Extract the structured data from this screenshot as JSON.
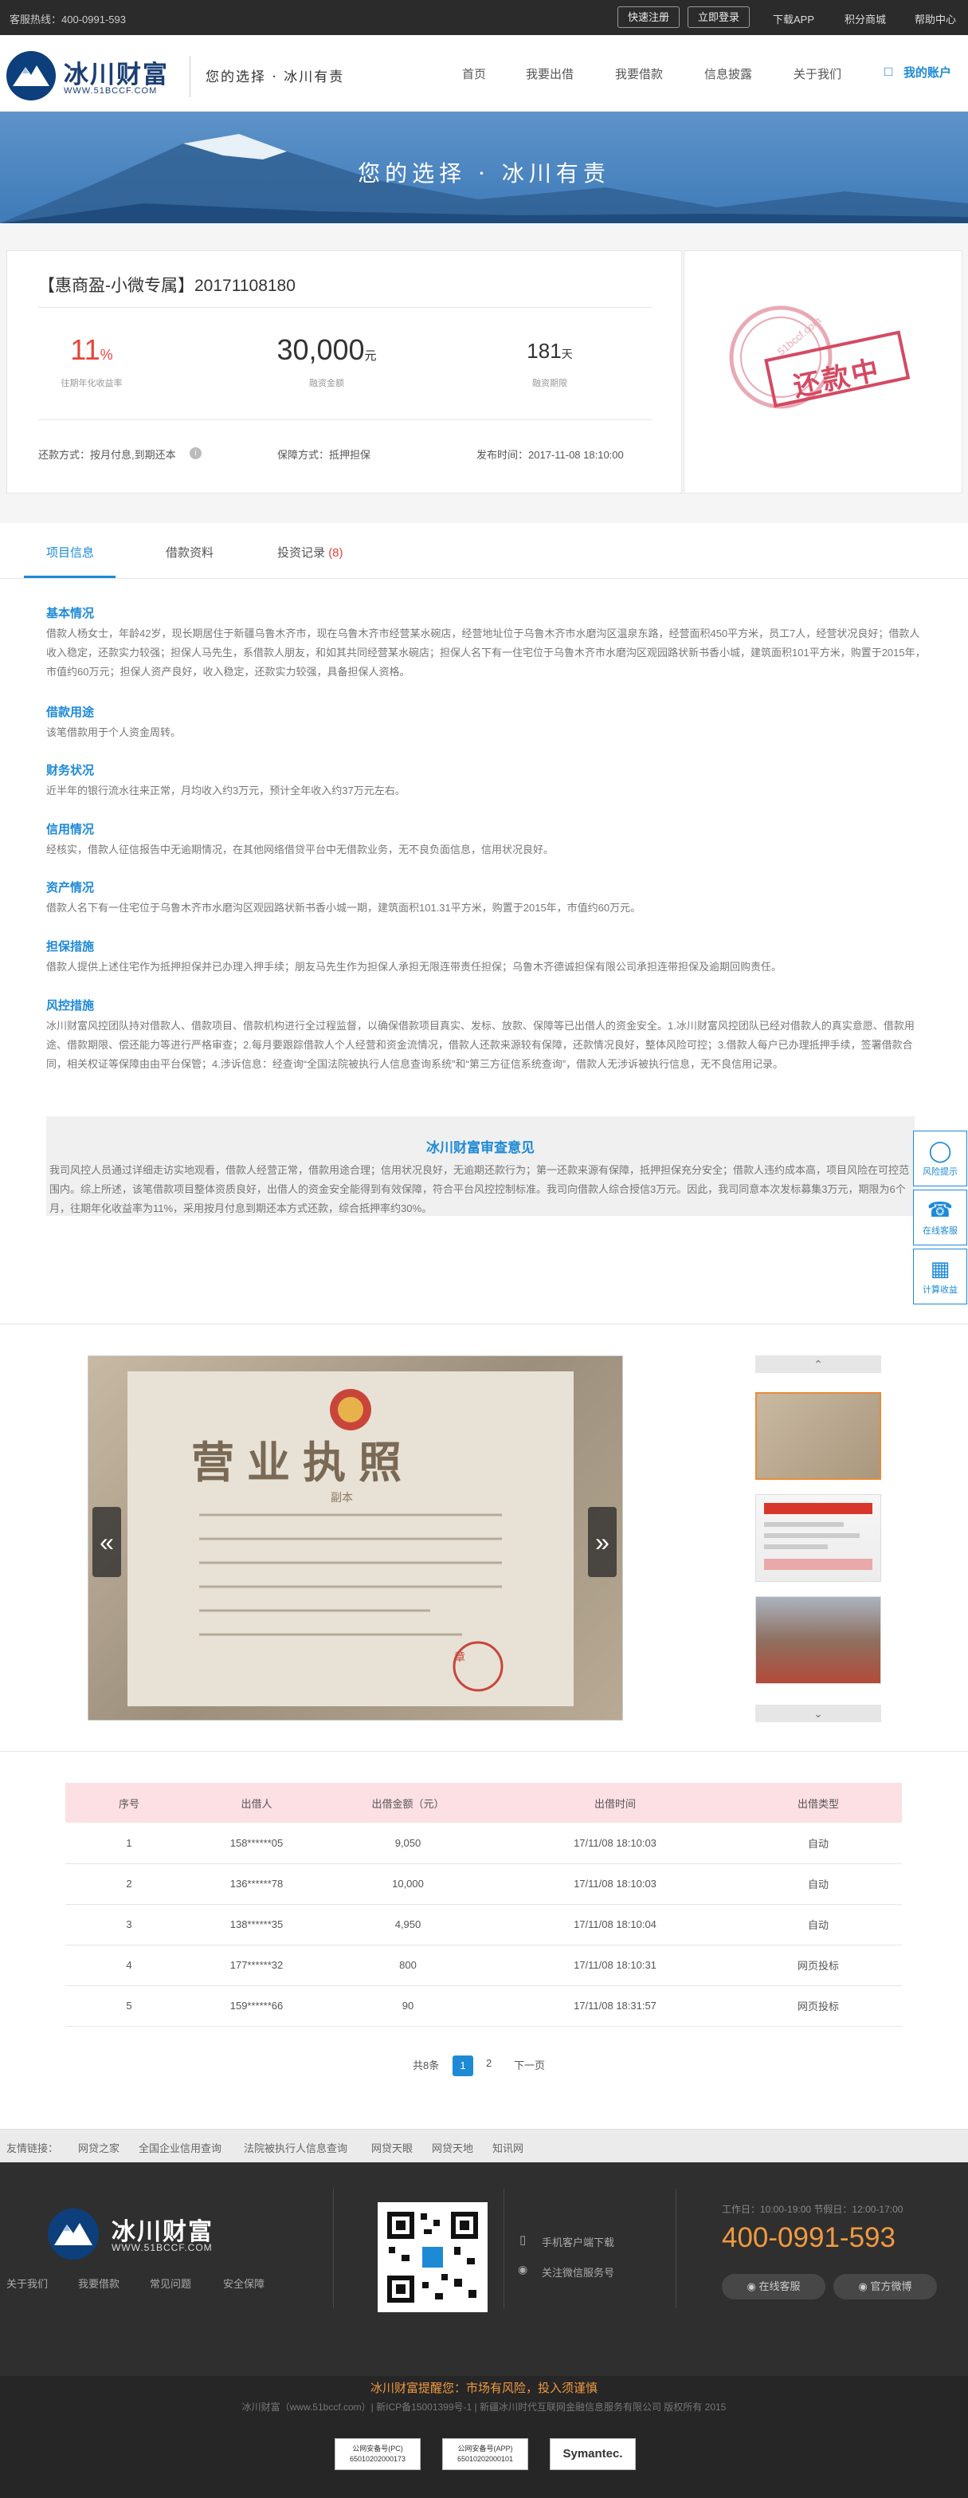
{
  "topbar": {
    "hotline": "客服热线：400-0991-593",
    "register": "快速注册",
    "login": "立即登录",
    "download": "下载APP",
    "points": "积分商城",
    "help": "帮助中心"
  },
  "header": {
    "brand": "冰川财富",
    "url": "WWW.51BCCF.COM",
    "slogan": "您的选择 · 冰川有责",
    "nav": [
      "首页",
      "我要出借",
      "我要借款",
      "信息披露",
      "关于我们"
    ],
    "account": "我的账户"
  },
  "banner": {
    "text": "您的选择 · 冰川有责"
  },
  "project": {
    "title": "【惠商盈-小微专属】20171108180",
    "rate_num": "11",
    "rate_unit": "%",
    "rate_label": "往期年化收益率",
    "amount_num": "30,000",
    "amount_unit": "元",
    "amount_label": "融资金额",
    "term_num": "181",
    "term_unit": "天",
    "term_label": "融资期限",
    "repay": "还款方式：按月付息,到期还本",
    "guarantee": "保障方式：抵押担保",
    "publish": "发布时间：2017-11-08 18:10:00",
    "stamp": "还款中",
    "stamp_url": "51bccf.com"
  },
  "tabs": {
    "t1": "项目信息",
    "t2": "借款资料",
    "t3": "投资记录",
    "t3_count": "(8)"
  },
  "sections": [
    {
      "h": "基本情况",
      "p": "借款人杨女士，年龄42岁，现长期居住于新疆乌鲁木齐市，现在乌鲁木齐市经营某水碗店，经营地址位于乌鲁木齐市水磨沟区温泉东路，经营面积450平方米，员工7人，经营状况良好；借款人收入稳定，还款实力较强；担保人马先生，系借款人朋友，和如其共同经营某水碗店；担保人名下有一住宅位于乌鲁木齐市水磨沟区观园路状新书香小城，建筑面积101平方米，购置于2015年，市值约60万元；担保人资产良好，收入稳定，还款实力较强，具备担保人资格。"
    },
    {
      "h": "借款用途",
      "p": "该笔借款用于个人资金周转。"
    },
    {
      "h": "财务状况",
      "p": "近半年的银行流水往来正常，月均收入约3万元，预计全年收入约37万元左右。"
    },
    {
      "h": "信用情况",
      "p": "经核实，借款人征信报告中无逾期情况，在其他网络借贷平台中无借款业务，无不良负面信息，信用状况良好。"
    },
    {
      "h": "资产情况",
      "p": "借款人名下有一住宅位于乌鲁木齐市水磨沟区观园路状新书香小城一期，建筑面积101.31平方米，购置于2015年，市值约60万元。"
    },
    {
      "h": "担保措施",
      "p": "借款人提供上述住宅作为抵押担保并已办理入押手续；朋友马先生作为担保人承担无限连带责任担保；乌鲁木齐德诚担保有限公司承担连带担保及逾期回购责任。"
    },
    {
      "h": "风控措施",
      "p": "冰川财富风控团队持对借款人、借款项目、借款机构进行全过程监督，以确保借款项目真实、发标、放款、保障等已出借人的资金安全。1.冰川财富风控团队已经对借款人的真实意愿、借款用途、借款期限、偿还能力等进行严格审查；2.每月要跟踪借款人个人经营和资金流情况，借款人还款来源较有保障，还款情况良好，整体风险可控；3.借款人每户已办理抵押手续，签署借款合同，相关权证等保障由由平台保管；4.涉诉信息：经查询“全国法院被执行人信息查询系统”和“第三方征信系统查询”，借款人无涉诉被执行信息，无不良信用记录。"
    }
  ],
  "review": {
    "h": "冰川财富审查意见",
    "p": "我司风控人员通过详细走访实地观看，借款人经营正常，借款用途合理；信用状况良好，无逾期还款行为；第一还款来源有保障，抵押担保充分安全；借款人违约成本高，项目风险在可控范围内。综上所述，该笔借款项目整体资质良好，出借人的资金安全能得到有效保障，符合平台风控控制标准。我司向借款人综合授信3万元。因此，我司同意本次发标募集3万元，期限为6个月，往期年化收益率为11%，采用按月付息到期还本方式还款，综合抵押率约30%。"
  },
  "side": {
    "s1": "风险提示",
    "s2": "在线客服",
    "s3": "计算收益"
  },
  "gallery": {
    "license_title": "营业执照",
    "license_sub": "副本",
    "seal": "章"
  },
  "table": {
    "headers": [
      "序号",
      "出借人",
      "出借金额（元）",
      "出借时间",
      "出借类型"
    ],
    "rows": [
      [
        "1",
        "158******05",
        "9,050",
        "17/11/08 18:10:03",
        "自动"
      ],
      [
        "2",
        "136******78",
        "10,000",
        "17/11/08 18:10:03",
        "自动"
      ],
      [
        "3",
        "138******35",
        "4,950",
        "17/11/08 18:10:04",
        "自动"
      ],
      [
        "4",
        "177******32",
        "800",
        "17/11/08 18:10:31",
        "网页投标"
      ],
      [
        "5",
        "159******66",
        "90",
        "17/11/08 18:31:57",
        "网页投标"
      ]
    ]
  },
  "pager": {
    "total": "共8条",
    "p1": "1",
    "p2": "2",
    "next": "下一页"
  },
  "friend": {
    "label": "友情链接：",
    "links": [
      "网贷之家",
      "全国企业信用查询",
      "法院被执行人信息查询",
      "网贷天眼",
      "网贷天地",
      "知讯网"
    ]
  },
  "footer": {
    "brand": "冰川财富",
    "url": "WWW.51BCCF.COM",
    "links": [
      "关于我们",
      "我要借款",
      "常见问题",
      "安全保障"
    ],
    "app": "手机客户端下载",
    "wechat": "关注微信服务号",
    "hours": "工作日：10:00-19:00 节假日：12:00-17:00",
    "phone": "400-0991-593",
    "btn1": "在线客服",
    "btn2": "官方微博"
  },
  "bottom": {
    "warn": "冰川财富提醒您：市场有风险，投入须谨慎",
    "copy": "冰川财富（www.51bccf.com）| 新ICP备15001399号-1 | 新疆冰川时代互联网金融信息服务有限公司 版权所有 2015",
    "b1": "公网安备号(PC) 65010202000173",
    "b2": "公网安备号(APP) 65010202000101",
    "b3": "Symantec."
  },
  "colors": {
    "accent": "#1e8ad6",
    "rate": "#e8443a",
    "phone": "#f19a40",
    "stamp": "#d44a63"
  }
}
